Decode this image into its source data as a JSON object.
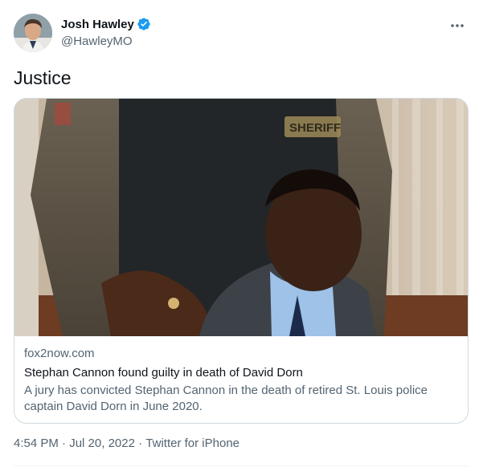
{
  "author": {
    "name": "Josh Hawley",
    "handle": "@HawleyMO",
    "verified": true
  },
  "tweet": {
    "text": "Justice"
  },
  "card": {
    "domain": "fox2now.com",
    "title": "Stephan Cannon found guilty in death of David Dorn",
    "description": "A jury has convicted Stephan Cannon in the death of retired St. Louis police captain David Dorn in June 2020.",
    "image_badge_text": "SHERIFF"
  },
  "meta": {
    "time": "4:54 PM",
    "separator": " · ",
    "date": "Jul 20, 2022",
    "source": "Twitter for iPhone"
  },
  "icons": {
    "verified": "verified-badge-icon",
    "more": "more-horizontal-icon"
  },
  "colors": {
    "verified_blue": "#1d9bf0",
    "secondary_text": "#536471",
    "border": "#cfd9de"
  }
}
